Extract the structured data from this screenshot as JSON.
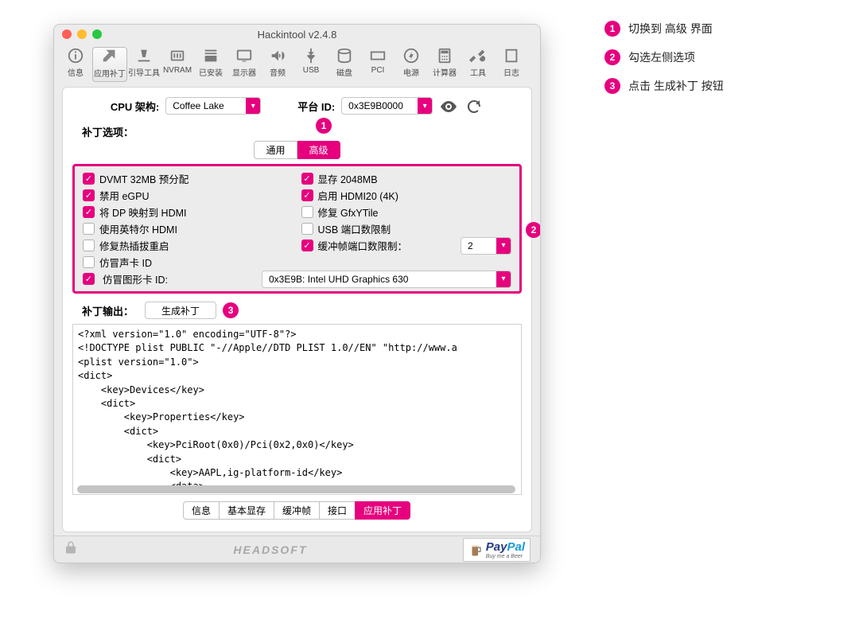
{
  "window_title": "Hackintool v2.4.8",
  "toolbar": [
    {
      "id": "info",
      "label": "信息"
    },
    {
      "id": "patch",
      "label": "应用补丁"
    },
    {
      "id": "bootloader",
      "label": "引导工具"
    },
    {
      "id": "nvram",
      "label": "NVRAM"
    },
    {
      "id": "installed",
      "label": "已安装"
    },
    {
      "id": "display",
      "label": "显示器"
    },
    {
      "id": "audio",
      "label": "音频"
    },
    {
      "id": "usb",
      "label": "USB"
    },
    {
      "id": "disks",
      "label": "磁盘"
    },
    {
      "id": "pci",
      "label": "PCI"
    },
    {
      "id": "power",
      "label": "电源"
    },
    {
      "id": "calc",
      "label": "计算器"
    },
    {
      "id": "tools",
      "label": "工具"
    },
    {
      "id": "logs",
      "label": "日志"
    }
  ],
  "cpu": {
    "label": "CPU 架构:",
    "value": "Coffee Lake",
    "platform_label": "平台 ID:",
    "platform_value": "0x3E9B0000"
  },
  "patch": {
    "options_label": "补丁选项：",
    "tabs": [
      "通用",
      "高级"
    ],
    "active_tab": "高级"
  },
  "options": {
    "left": [
      {
        "label": "DVMT 32MB 预分配",
        "checked": true
      },
      {
        "label": "禁用 eGPU",
        "checked": true
      },
      {
        "label": "将 DP 映射到 HDMI",
        "checked": true
      },
      {
        "label": "使用英特尔 HDMI",
        "checked": false
      },
      {
        "label": "修复热插拔重启",
        "checked": false
      },
      {
        "label": "仿冒声卡 ID",
        "checked": false
      }
    ],
    "right": [
      {
        "label": "显存 2048MB",
        "checked": true
      },
      {
        "label": "启用 HDMI20 (4K)",
        "checked": true
      },
      {
        "label": "修复 GfxYTile",
        "checked": false
      },
      {
        "label": "USB 端口数限制",
        "checked": false
      },
      {
        "label": "缓冲帧端口数限制：",
        "checked": true,
        "select": "2"
      }
    ],
    "spoof_gfx": {
      "label": "仿冒图形卡 ID:",
      "checked": true,
      "value": "0x3E9B: Intel UHD Graphics 630"
    }
  },
  "output": {
    "label": "补丁输出：",
    "button": "生成补丁",
    "tabs": [
      "信息",
      "基本显存",
      "缓冲帧",
      "接口",
      "应用补丁"
    ],
    "active": "应用补丁",
    "code": "<?xml version=\"1.0\" encoding=\"UTF-8\"?>\n<!DOCTYPE plist PUBLIC \"-//Apple//DTD PLIST 1.0//EN\" \"http://www.a\n<plist version=\"1.0\">\n<dict>\n    <key>Devices</key>\n    <dict>\n        <key>Properties</key>\n        <dict>\n            <key>PciRoot(0x0)/Pci(0x2,0x0)</key>\n            <dict>\n                <key>AAPL,ig-platform-id</key>\n                <data>\n                AACbPg==\n                </data>\n                <key>AAPL,slot-name</key>"
  },
  "footer": {
    "brand": "HEADSOFT",
    "paypal": "PayPal",
    "paypal_sub": "Buy me a Beer"
  },
  "legend": [
    {
      "n": "1",
      "text": "切换到 高级 界面"
    },
    {
      "n": "2",
      "text": "勾选左侧选项"
    },
    {
      "n": "3",
      "text": "点击 生成补丁 按钮"
    }
  ]
}
